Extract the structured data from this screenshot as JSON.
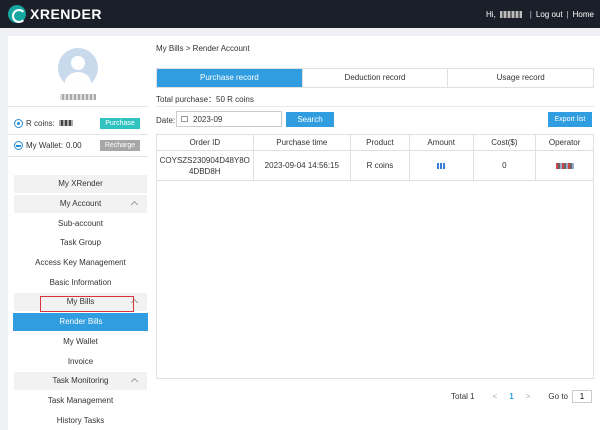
{
  "header": {
    "logo_text": "XRENDER",
    "greeting": "Hi,",
    "logout_label": "Log out",
    "home_label": "Home",
    "separator": "|"
  },
  "sidebar": {
    "rcoins_label": "R coins:",
    "purchase_label": "Purchase",
    "wallet_label": "My Wallet:",
    "wallet_value": "0.00",
    "recharge_label": "Recharge",
    "menu": [
      {
        "label": "My XRender"
      },
      {
        "label": "My Account"
      },
      {
        "label": "Sub-account"
      },
      {
        "label": "Task Group"
      },
      {
        "label": "Access Key Management"
      },
      {
        "label": "Basic Information"
      },
      {
        "label": "My Bills"
      },
      {
        "label": "Render Bills"
      },
      {
        "label": "My Wallet"
      },
      {
        "label": "Invoice"
      },
      {
        "label": "Task Monitoring"
      },
      {
        "label": "Task Management"
      },
      {
        "label": "History Tasks"
      }
    ]
  },
  "main": {
    "breadcrumb": "My Bills > Render Account",
    "tabs": [
      {
        "label": "Purchase record"
      },
      {
        "label": "Deduction record"
      },
      {
        "label": "Usage record"
      }
    ],
    "total_purchase": "Total purchase：50 R coins",
    "date_label": "Date:",
    "date_value": "2023-09",
    "search_label": "Search",
    "export_label": "Export list",
    "table": {
      "columns": [
        "Order ID",
        "Purchase time",
        "Product",
        "Amount",
        "Cost($)",
        "Operator"
      ],
      "rows": [
        {
          "order_id": "COYSZS230904D48Y8O4DBD8H",
          "time": "2023-09-04 14:56:15",
          "product": "R coins",
          "cost": "0"
        }
      ]
    },
    "pager": {
      "total": "Total 1",
      "prev": "<",
      "page": "1",
      "next": ">",
      "goto_label": "Go to",
      "goto_value": "1"
    }
  }
}
